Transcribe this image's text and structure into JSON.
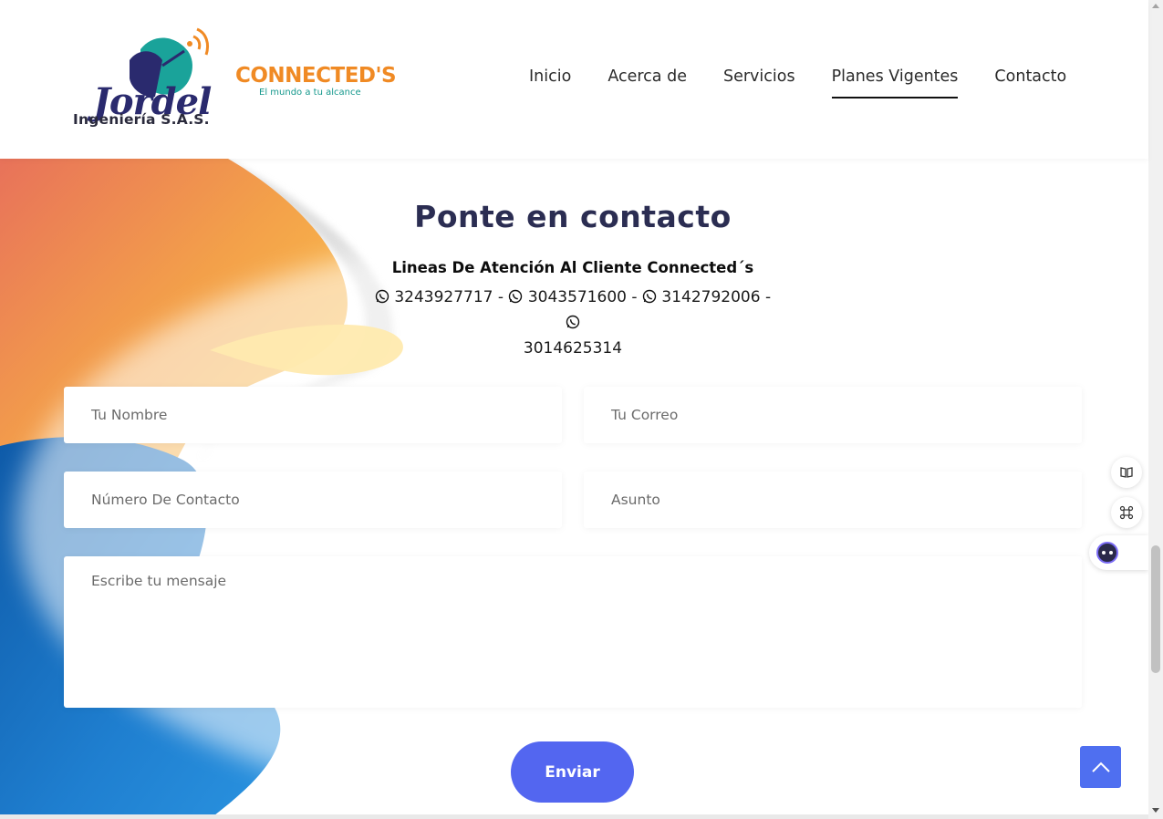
{
  "logos": {
    "jordel_script": "Jordel",
    "jordel_sub": "Ingeniería S.A.S.",
    "connected_brand": "CONNECTED'S",
    "connected_tag": "El mundo a tu alcance"
  },
  "nav": {
    "items": [
      {
        "label": "Inicio",
        "active": false
      },
      {
        "label": "Acerca de",
        "active": false
      },
      {
        "label": "Servicios",
        "active": false
      },
      {
        "label": "Planes Vigentes",
        "active": true
      },
      {
        "label": "Contacto",
        "active": false
      }
    ]
  },
  "contact": {
    "title": "Ponte en contacto",
    "lines_title": "Lineas De Atención Al Cliente Connected´s",
    "phones": [
      "3243927717",
      "3043571600",
      "3142792006",
      "3014625314"
    ],
    "separator": " - "
  },
  "form": {
    "name_placeholder": "Tu Nombre",
    "email_placeholder": "Tu Correo",
    "phone_placeholder": "Número De Contacto",
    "subject_placeholder": "Asunto",
    "message_placeholder": "Escribe tu mensaje",
    "submit_label": "Enviar"
  },
  "colors": {
    "accent": "#5366f0",
    "title": "#2b2d52",
    "brand_orange": "#f08a24",
    "brand_teal": "#15988c"
  },
  "icons": {
    "phone": "whatsapp-icon",
    "scroll_top": "chevron-up-icon",
    "side_tool_1": "book-icon",
    "side_tool_2": "command-icon",
    "side_tool_3": "bot-icon"
  }
}
